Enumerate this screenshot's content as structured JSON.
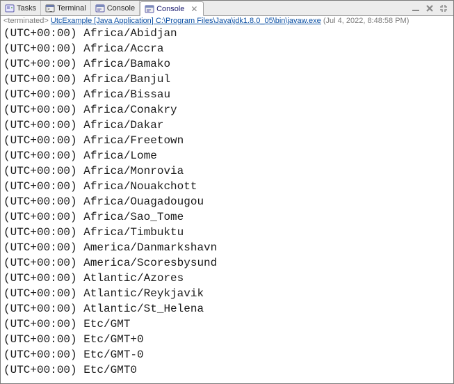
{
  "tabs": [
    {
      "label": "Tasks",
      "icon": "tasks-icon"
    },
    {
      "label": "Terminal",
      "icon": "terminal-icon"
    },
    {
      "label": "Console",
      "icon": "console-icon"
    },
    {
      "label": "Console",
      "icon": "console-icon"
    }
  ],
  "active_tab_index": 3,
  "status": {
    "prefix": "<terminated>",
    "app": "UtcExample",
    "apptype": "[Java Application]",
    "path": "C:\\Program Files\\Java\\jdk1.8.0_05\\bin\\javaw.exe",
    "timestamp": "(Jul 4, 2022, 8:48:58 PM)"
  },
  "output": [
    {
      "offset": "(UTC+00:00)",
      "zone": "Africa/Abidjan"
    },
    {
      "offset": "(UTC+00:00)",
      "zone": "Africa/Accra"
    },
    {
      "offset": "(UTC+00:00)",
      "zone": "Africa/Bamako"
    },
    {
      "offset": "(UTC+00:00)",
      "zone": "Africa/Banjul"
    },
    {
      "offset": "(UTC+00:00)",
      "zone": "Africa/Bissau"
    },
    {
      "offset": "(UTC+00:00)",
      "zone": "Africa/Conakry"
    },
    {
      "offset": "(UTC+00:00)",
      "zone": "Africa/Dakar"
    },
    {
      "offset": "(UTC+00:00)",
      "zone": "Africa/Freetown"
    },
    {
      "offset": "(UTC+00:00)",
      "zone": "Africa/Lome"
    },
    {
      "offset": "(UTC+00:00)",
      "zone": "Africa/Monrovia"
    },
    {
      "offset": "(UTC+00:00)",
      "zone": "Africa/Nouakchott"
    },
    {
      "offset": "(UTC+00:00)",
      "zone": "Africa/Ouagadougou"
    },
    {
      "offset": "(UTC+00:00)",
      "zone": "Africa/Sao_Tome"
    },
    {
      "offset": "(UTC+00:00)",
      "zone": "Africa/Timbuktu"
    },
    {
      "offset": "(UTC+00:00)",
      "zone": "America/Danmarkshavn"
    },
    {
      "offset": "(UTC+00:00)",
      "zone": "America/Scoresbysund"
    },
    {
      "offset": "(UTC+00:00)",
      "zone": "Atlantic/Azores"
    },
    {
      "offset": "(UTC+00:00)",
      "zone": "Atlantic/Reykjavik"
    },
    {
      "offset": "(UTC+00:00)",
      "zone": "Atlantic/St_Helena"
    },
    {
      "offset": "(UTC+00:00)",
      "zone": "Etc/GMT"
    },
    {
      "offset": "(UTC+00:00)",
      "zone": "Etc/GMT+0"
    },
    {
      "offset": "(UTC+00:00)",
      "zone": "Etc/GMT-0"
    },
    {
      "offset": "(UTC+00:00)",
      "zone": "Etc/GMT0"
    }
  ]
}
